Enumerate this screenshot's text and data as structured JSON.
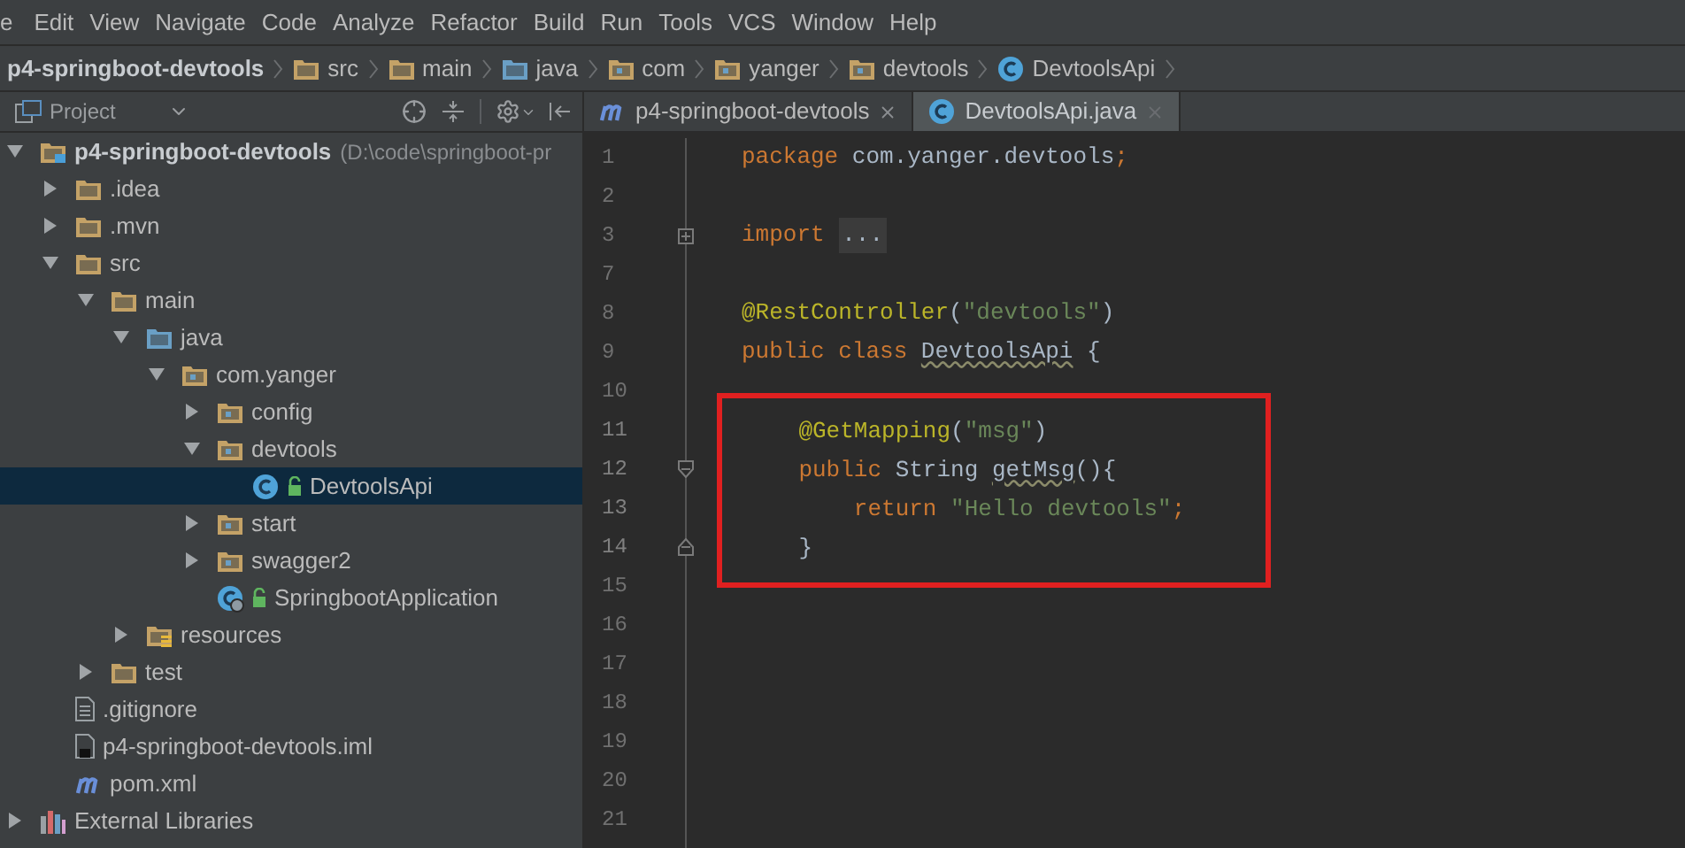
{
  "menu": [
    "e",
    "Edit",
    "View",
    "Navigate",
    "Code",
    "Analyze",
    "Refactor",
    "Build",
    "Run",
    "Tools",
    "VCS",
    "Window",
    "Help"
  ],
  "breadcrumb": [
    {
      "label": "p4-springboot-devtools",
      "kind": "module"
    },
    {
      "label": "src",
      "kind": "folder"
    },
    {
      "label": "main",
      "kind": "folder"
    },
    {
      "label": "java",
      "kind": "source"
    },
    {
      "label": "com",
      "kind": "package"
    },
    {
      "label": "yanger",
      "kind": "package"
    },
    {
      "label": "devtools",
      "kind": "package"
    },
    {
      "label": "DevtoolsApi",
      "kind": "class"
    }
  ],
  "project_panel": {
    "title": "Project",
    "tree": [
      {
        "label": "p4-springboot-devtools",
        "path": "(D:\\code\\springboot-pr",
        "kind": "module",
        "expanded": true,
        "selected": false,
        "children": [
          {
            "label": ".idea",
            "kind": "folder",
            "expanded": false,
            "selected": false
          },
          {
            "label": ".mvn",
            "kind": "folder",
            "expanded": false,
            "selected": false
          },
          {
            "label": "src",
            "kind": "folder",
            "expanded": true,
            "selected": false,
            "children": [
              {
                "label": "main",
                "kind": "folder",
                "expanded": true,
                "selected": false,
                "children": [
                  {
                    "label": "java",
                    "kind": "source",
                    "expanded": true,
                    "selected": false,
                    "children": [
                      {
                        "label": "com.yanger",
                        "kind": "package",
                        "expanded": true,
                        "selected": false,
                        "children": [
                          {
                            "label": "config",
                            "kind": "package",
                            "expanded": false,
                            "selected": false
                          },
                          {
                            "label": "devtools",
                            "kind": "package",
                            "expanded": true,
                            "selected": false,
                            "children": [
                              {
                                "label": "DevtoolsApi",
                                "kind": "class",
                                "selected": true
                              }
                            ]
                          },
                          {
                            "label": "start",
                            "kind": "package",
                            "expanded": false,
                            "selected": false
                          },
                          {
                            "label": "swagger2",
                            "kind": "package",
                            "expanded": false,
                            "selected": false
                          },
                          {
                            "label": "SpringbootApplication",
                            "kind": "boot",
                            "selected": false
                          }
                        ]
                      }
                    ]
                  },
                  {
                    "label": "resources",
                    "kind": "resources",
                    "expanded": false,
                    "selected": false
                  }
                ]
              },
              {
                "label": "test",
                "kind": "folder",
                "expanded": false,
                "selected": false
              }
            ]
          },
          {
            "label": ".gitignore",
            "kind": "text",
            "selected": false
          },
          {
            "label": "p4-springboot-devtools.iml",
            "kind": "iml",
            "selected": false
          },
          {
            "label": "pom.xml",
            "kind": "maven",
            "selected": false
          }
        ]
      },
      {
        "label": "External Libraries",
        "kind": "libraries",
        "expanded": false,
        "selected": false
      }
    ]
  },
  "editor_tabs": [
    {
      "label": "p4-springboot-devtools",
      "kind": "maven",
      "selected": false
    },
    {
      "label": "DevtoolsApi.java",
      "kind": "class",
      "selected": true
    }
  ],
  "code": [
    {
      "number": "1",
      "kind": "plain",
      "highlighted": false,
      "tokens": [
        {
          "kind": "kw",
          "text": "package"
        },
        {
          "kind": "plain",
          "text": " com.yanger.devtools"
        },
        {
          "kind": "kw",
          "text": ";"
        }
      ]
    },
    {
      "number": "2",
      "kind": "plain",
      "highlighted": false
    },
    {
      "number": "3",
      "kind": "fold-collapsed",
      "highlighted": false,
      "tokens": [
        {
          "kind": "kw",
          "text": "import "
        },
        {
          "kind": "folded",
          "text": "..."
        }
      ]
    },
    {
      "number": "7",
      "kind": "plain",
      "highlighted": false
    },
    {
      "number": "8",
      "kind": "plain",
      "highlighted": false,
      "tokens": [
        {
          "kind": "ann",
          "text": "@RestController"
        },
        {
          "kind": "plain",
          "text": "("
        },
        {
          "kind": "str",
          "text": "\"devtools\""
        },
        {
          "kind": "plain",
          "text": ")"
        }
      ]
    },
    {
      "number": "9",
      "kind": "plain",
      "highlighted": false,
      "tokens": [
        {
          "kind": "kw",
          "text": "public class "
        },
        {
          "kind": "unused",
          "text": "DevtoolsApi"
        },
        {
          "kind": "plain",
          "text": " {"
        }
      ]
    },
    {
      "number": "10",
      "kind": "plain",
      "highlighted": false
    },
    {
      "number": "11",
      "kind": "plain",
      "highlighted": true,
      "tokens": [
        {
          "kind": "ann",
          "text": "    @GetMapping"
        },
        {
          "kind": "plain",
          "text": "("
        },
        {
          "kind": "str",
          "text": "\"msg\""
        },
        {
          "kind": "plain",
          "text": ")"
        }
      ]
    },
    {
      "number": "12",
      "kind": "fold-start",
      "highlighted": true,
      "tokens": [
        {
          "kind": "kw",
          "text": "    public"
        },
        {
          "kind": "plain",
          "text": " String "
        },
        {
          "kind": "unused",
          "text": "getMsg"
        },
        {
          "kind": "plain",
          "text": "(){"
        }
      ]
    },
    {
      "number": "13",
      "kind": "plain",
      "highlighted": true,
      "tokens": [
        {
          "kind": "kw",
          "text": "        return "
        },
        {
          "kind": "str",
          "text": "\"Hello devtools\""
        },
        {
          "kind": "kw",
          "text": ";"
        }
      ]
    },
    {
      "number": "14",
      "kind": "fold-end",
      "highlighted": true,
      "tokens": [
        {
          "kind": "plain",
          "text": "    }"
        }
      ]
    },
    {
      "number": "15",
      "kind": "plain",
      "highlighted": false
    },
    {
      "number": "16",
      "kind": "plain",
      "highlighted": false
    },
    {
      "number": "17",
      "kind": "plain",
      "highlighted": false
    },
    {
      "number": "18",
      "kind": "plain",
      "highlighted": false
    },
    {
      "number": "19",
      "kind": "plain",
      "highlighted": false
    },
    {
      "number": "20",
      "kind": "plain",
      "highlighted": false
    },
    {
      "number": "21",
      "kind": "plain",
      "highlighted": false
    }
  ]
}
